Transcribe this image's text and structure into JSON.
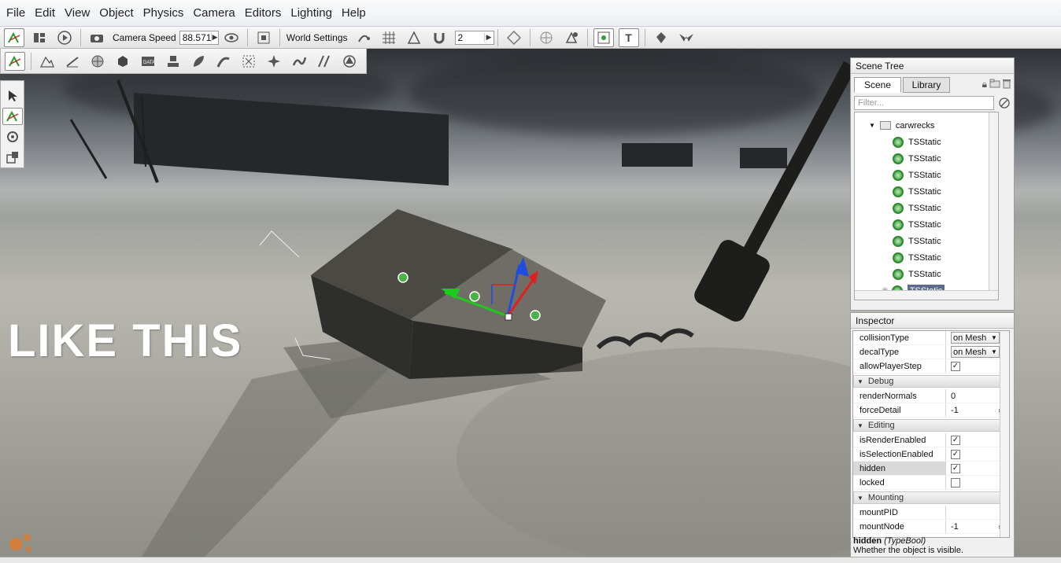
{
  "menu": [
    "File",
    "Edit",
    "View",
    "Object",
    "Physics",
    "Camera",
    "Editors",
    "Lighting",
    "Help"
  ],
  "toolbar": {
    "camera_speed_label": "Camera Speed",
    "camera_speed_value": "88.571",
    "world_settings_label": "World Settings",
    "snap_value": "2"
  },
  "overlay_text": "LIKE THIS",
  "scene_tree": {
    "title": "Scene Tree",
    "tabs": [
      "Scene",
      "Library"
    ],
    "filter_placeholder": "Filter...",
    "folder_label": "carwrecks",
    "items": [
      "TSStatic",
      "TSStatic",
      "TSStatic",
      "TSStatic",
      "TSStatic",
      "TSStatic",
      "TSStatic",
      "TSStatic",
      "TSStatic",
      "TSStatic"
    ]
  },
  "inspector": {
    "title": "Inspector",
    "rows_top": [
      {
        "name": "collisionType",
        "value": "on Mesh"
      },
      {
        "name": "decalType",
        "value": "on Mesh"
      },
      {
        "name": "allowPlayerStep",
        "value": "checked"
      }
    ],
    "group_debug": "Debug",
    "debug_rows": [
      {
        "name": "renderNormals",
        "value": "0"
      },
      {
        "name": "forceDetail",
        "value": "-1"
      }
    ],
    "group_editing": "Editing",
    "editing_rows": [
      {
        "name": "isRenderEnabled",
        "value": "checked"
      },
      {
        "name": "isSelectionEnabled",
        "value": "checked"
      },
      {
        "name": "hidden",
        "value": "checked"
      },
      {
        "name": "locked",
        "value": "unchecked"
      }
    ],
    "group_mounting": "Mounting",
    "mounting_rows": [
      {
        "name": "mountPID",
        "value": ""
      },
      {
        "name": "mountNode",
        "value": "-1"
      }
    ],
    "help_field": "hidden",
    "help_type": "(TypeBool)",
    "help_desc": "Whether the object is visible."
  },
  "colors": {
    "selection": "#5c6b8a",
    "ts_icon": "#3b9a3b"
  }
}
